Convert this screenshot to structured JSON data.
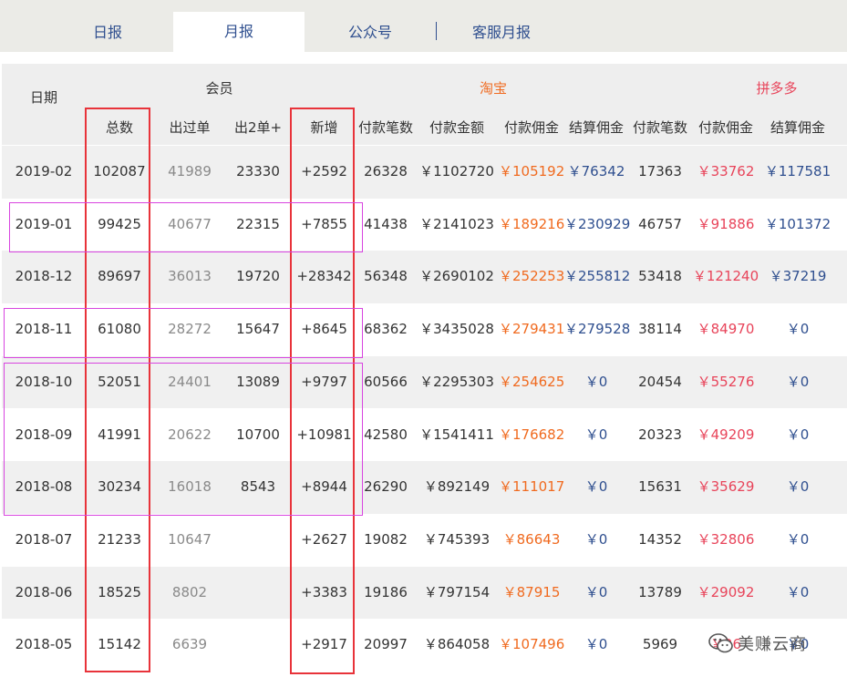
{
  "tabs": [
    {
      "label": "日报",
      "active": false
    },
    {
      "label": "月报",
      "active": true
    },
    {
      "label": "公众号",
      "active": false
    },
    {
      "label": "客服月报",
      "active": false
    }
  ],
  "header": {
    "date": "日期",
    "group_member": "会员",
    "group_taobao": "淘宝",
    "group_pdd": "拼多多",
    "cols": [
      "总数",
      "出过单",
      "出2单+",
      "新增",
      "付款笔数",
      "付款金额",
      "付款佣金",
      "结算佣金",
      "付款笔数",
      "付款佣金",
      "结算佣金"
    ]
  },
  "rows": [
    [
      "2019-02",
      "102087",
      "41989",
      "23330",
      "+2592",
      "26328",
      "￥1102720",
      "￥105192",
      "￥76342",
      "17363",
      "￥33762",
      "￥117581"
    ],
    [
      "2019-01",
      "99425",
      "40677",
      "22315",
      "+7855",
      "41438",
      "￥2141023",
      "￥189216",
      "￥230929",
      "46757",
      "￥91886",
      "￥101372"
    ],
    [
      "2018-12",
      "89697",
      "36013",
      "19720",
      "+28342",
      "56348",
      "￥2690102",
      "￥252253",
      "￥255812",
      "53418",
      "￥121240",
      "￥37219"
    ],
    [
      "2018-11",
      "61080",
      "28272",
      "15647",
      "+8645",
      "68362",
      "￥3435028",
      "￥279431",
      "￥279528",
      "38114",
      "￥84970",
      "￥0"
    ],
    [
      "2018-10",
      "52051",
      "24401",
      "13089",
      "+9797",
      "60566",
      "￥2295303",
      "￥254625",
      "￥0",
      "20454",
      "￥55276",
      "￥0"
    ],
    [
      "2018-09",
      "41991",
      "20622",
      "10700",
      "+10981",
      "42580",
      "￥1541411",
      "￥176682",
      "￥0",
      "20323",
      "￥49209",
      "￥0"
    ],
    [
      "2018-08",
      "30234",
      "16018",
      "8543",
      "+8944",
      "26290",
      "￥892149",
      "￥111017",
      "￥0",
      "15631",
      "￥35629",
      "￥0"
    ],
    [
      "2018-07",
      "21233",
      "10647",
      "",
      "+2627",
      "19082",
      "￥745393",
      "￥86643",
      "￥0",
      "14352",
      "￥32806",
      "￥0"
    ],
    [
      "2018-06",
      "18525",
      "8802",
      "",
      "+3383",
      "19186",
      "￥797154",
      "￥87915",
      "￥0",
      "13789",
      "￥29092",
      "￥0"
    ],
    [
      "2018-05",
      "15142",
      "6639",
      "",
      "+2917",
      "20997",
      "￥864058",
      "￥107496",
      "￥0",
      "5969",
      "￥26",
      "￥0"
    ]
  ],
  "colors": {
    "orange": "#f06a1f",
    "blue": "#2f4f8f",
    "red": "#e8445a",
    "dim": "#8a8a8a",
    "highlight_red": "#e8333a",
    "highlight_magenta": "#d845e0"
  },
  "watermark": {
    "icon": "wechat-icon",
    "text": "美赚云商"
  }
}
